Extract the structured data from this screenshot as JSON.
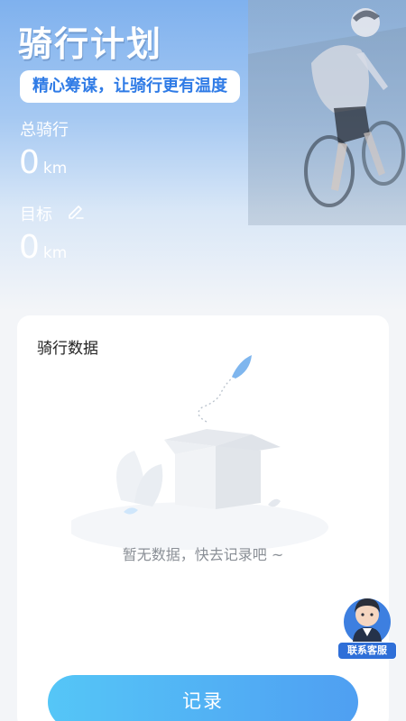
{
  "header": {
    "title": "骑行计划",
    "slogan": "精心筹谋，让骑行更有温度"
  },
  "stats": {
    "total_label": "总骑行",
    "total_value": "0",
    "total_unit": "km",
    "goal_label": "目标",
    "goal_value": "0",
    "goal_unit": "km"
  },
  "card": {
    "title": "骑行数据",
    "empty_text": "暂无数据，快去记录吧 ~"
  },
  "service": {
    "label": "联系客服"
  },
  "actions": {
    "record_label": "记录"
  },
  "colors": {
    "accent": "#2f7be6",
    "button_start": "#55c6f7",
    "button_end": "#4f9ff2"
  }
}
